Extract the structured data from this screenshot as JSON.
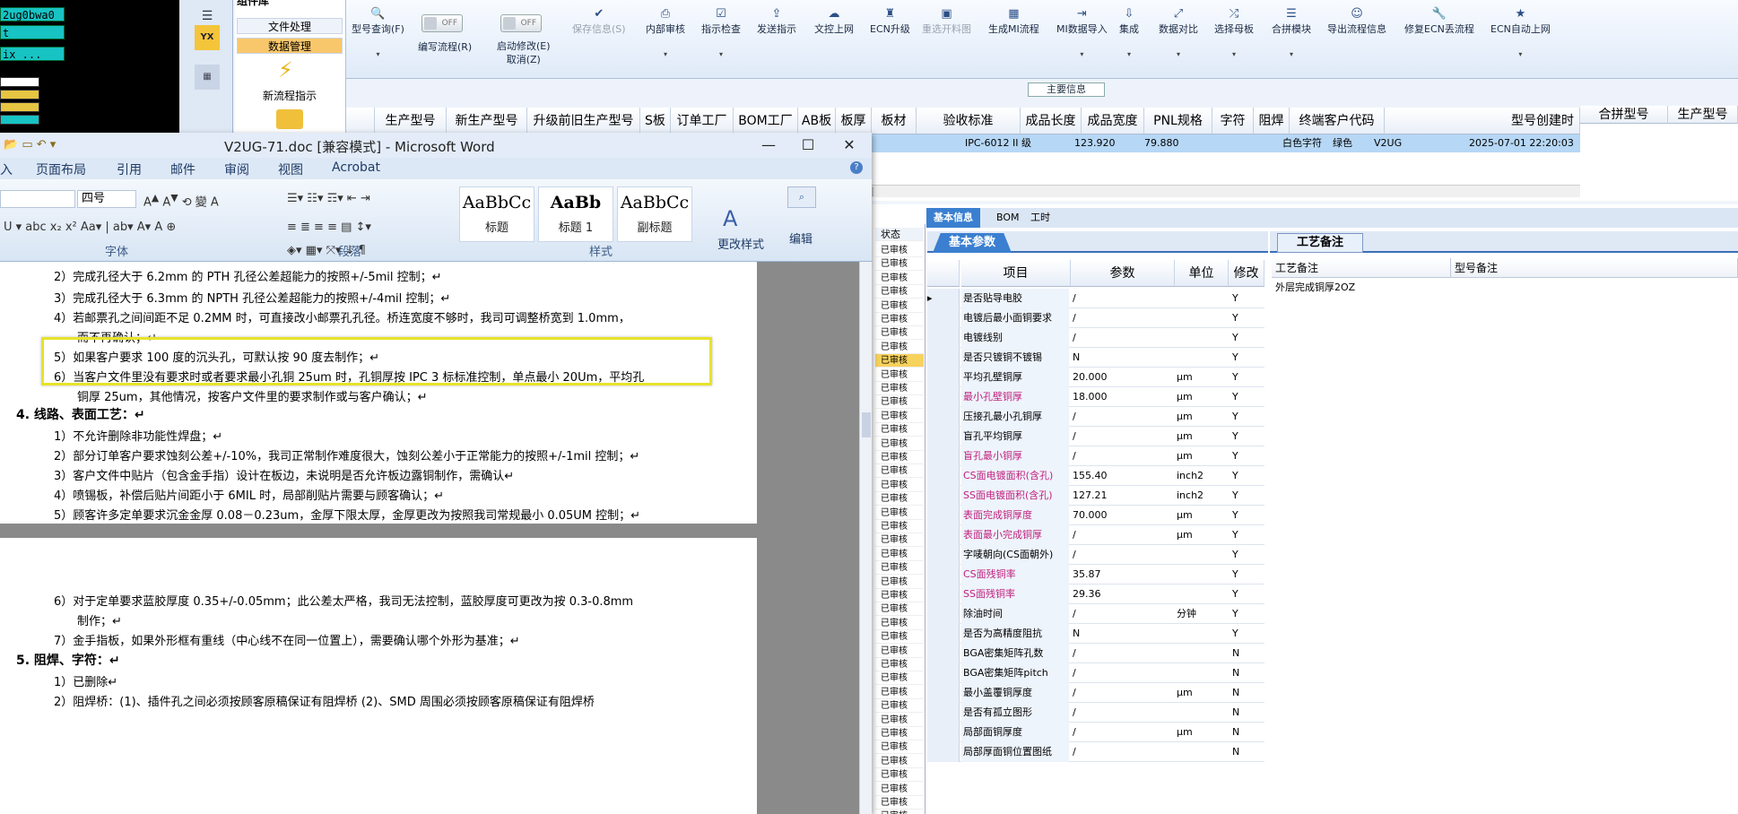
{
  "terminal": {
    "rows": [
      "2ug0bwa0",
      "t",
      "ix ..."
    ]
  },
  "leftnav": {
    "icon1": "YX",
    "top_label": "组件库"
  },
  "leftmenu": {
    "items": [
      "文件处理",
      "数据管理"
    ],
    "new_flow": "新流程指示"
  },
  "toolbar": {
    "items": [
      {
        "label": "型号查询(F)",
        "icon": "🔍",
        "dis": false
      },
      {
        "label": "编写流程(R)",
        "icon": "",
        "dis": false
      },
      {
        "label": "启动修改(E)\n取消(Z)",
        "icon": "",
        "dis": false
      },
      {
        "label": "保存信息(S)",
        "icon": "✔",
        "dis": true
      },
      {
        "label": "内部审核",
        "icon": "🖶",
        "dis": false
      },
      {
        "label": "指示检查",
        "icon": "☑",
        "dis": false
      },
      {
        "label": "发送指示",
        "icon": "⇪",
        "dis": false
      },
      {
        "label": "文控上网",
        "icon": "☁",
        "dis": false
      },
      {
        "label": "ECN升级",
        "icon": "♜",
        "dis": false
      },
      {
        "label": "重选开料图",
        "icon": "▣",
        "dis": true
      },
      {
        "label": "生成MI流程",
        "icon": "▦",
        "dis": false
      },
      {
        "label": "MI数据导入",
        "icon": "⇥",
        "dis": false
      },
      {
        "label": "集成",
        "icon": "⇩",
        "dis": false
      },
      {
        "label": "数据对比",
        "icon": "⤢",
        "dis": false
      },
      {
        "label": "选择母板",
        "icon": "⤮",
        "dis": false
      },
      {
        "label": "合拼模块",
        "icon": "☰",
        "dis": false
      },
      {
        "label": "导出流程信息",
        "icon": "☺",
        "dis": false
      },
      {
        "label": "修复ECN丢流程",
        "icon": "🔧",
        "dis": false
      },
      {
        "label": "ECN自动上网",
        "icon": "★",
        "dis": false
      }
    ],
    "toggle_text": "OFF"
  },
  "maingrid": {
    "section_title": "主要信息",
    "headers": [
      "生产型号",
      "新生产型号",
      "升级前旧生产型号",
      "S板",
      "订单工厂",
      "BOM工厂",
      "AB板",
      "板厚",
      "板材",
      "验收标准",
      "成品长度",
      "成品宽度",
      "PNL规格",
      "字符",
      "阻焊",
      "终端客户代码",
      "型号创建时",
      "合拼型号",
      "生产型号"
    ],
    "row": {
      "standard": "IPC-6012 II 级",
      "length": "123.920",
      "width": "79.880",
      "char": "白色字符",
      "mask": "绿色",
      "cust": "V2UG",
      "time": "2025-07-01 22:20:03"
    }
  },
  "tabs": [
    "基本信息",
    "BOM",
    "工时"
  ],
  "status": {
    "header": "状态",
    "item": "已审核"
  },
  "basic": {
    "tab": "基本参数",
    "headers": {
      "item": "项目",
      "param": "参数",
      "unit": "单位",
      "mod": "修改"
    },
    "rows": [
      {
        "n": "是否贴导电胶",
        "p": "/",
        "u": "",
        "m": "Y",
        "pink": false
      },
      {
        "n": "电镀后最小面铜要求",
        "p": "/",
        "u": "",
        "m": "Y",
        "pink": false
      },
      {
        "n": "电镀线别",
        "p": "/",
        "u": "",
        "m": "Y",
        "pink": false
      },
      {
        "n": "是否只镀铜不镀锡",
        "p": "N",
        "u": "",
        "m": "Y",
        "pink": false
      },
      {
        "n": "平均孔壁铜厚",
        "p": "20.000",
        "u": "μm",
        "m": "Y",
        "pink": false
      },
      {
        "n": "最小孔壁铜厚",
        "p": "18.000",
        "u": "μm",
        "m": "Y",
        "pink": true
      },
      {
        "n": "压接孔最小孔铜厚",
        "p": "/",
        "u": "μm",
        "m": "Y",
        "pink": false
      },
      {
        "n": "盲孔平均铜厚",
        "p": "/",
        "u": "μm",
        "m": "Y",
        "pink": false
      },
      {
        "n": "盲孔最小铜厚",
        "p": "/",
        "u": "μm",
        "m": "Y",
        "pink": true
      },
      {
        "n": "CS面电镀面积(含孔)",
        "p": "155.40",
        "u": "inch2",
        "m": "Y",
        "pink": true
      },
      {
        "n": "SS面电镀面积(含孔)",
        "p": "127.21",
        "u": "inch2",
        "m": "Y",
        "pink": true
      },
      {
        "n": "表面完成铜厚度",
        "p": "70.000",
        "u": "μm",
        "m": "Y",
        "pink": true
      },
      {
        "n": "表面最小完成铜厚",
        "p": "/",
        "u": "μm",
        "m": "Y",
        "pink": true
      },
      {
        "n": "字唛朝向(CS面朝外)",
        "p": "/",
        "u": "",
        "m": "Y",
        "pink": false
      },
      {
        "n": "CS面残铜率",
        "p": "35.87",
        "u": "",
        "m": "Y",
        "pink": true
      },
      {
        "n": "SS面残铜率",
        "p": "29.36",
        "u": "",
        "m": "Y",
        "pink": true
      },
      {
        "n": "除油时间",
        "p": "/",
        "u": "分钟",
        "m": "Y",
        "pink": false
      },
      {
        "n": "是否为高精度阻抗",
        "p": "N",
        "u": "",
        "m": "Y",
        "pink": false
      },
      {
        "n": "BGA密集矩阵孔数",
        "p": "/",
        "u": "",
        "m": "N",
        "pink": false
      },
      {
        "n": "BGA密集矩阵pitch",
        "p": "/",
        "u": "",
        "m": "N",
        "pink": false
      },
      {
        "n": "最小盖覆铜厚度",
        "p": "/",
        "u": "μm",
        "m": "N",
        "pink": false
      },
      {
        "n": "是否有孤立图形",
        "p": "/",
        "u": "",
        "m": "N",
        "pink": false
      },
      {
        "n": "局部面铜厚度",
        "p": "/",
        "u": "μm",
        "m": "N",
        "pink": false
      },
      {
        "n": "局部厚面铜位置图纸",
        "p": "/",
        "u": "",
        "m": "N",
        "pink": false
      }
    ]
  },
  "craft": {
    "tab": "工艺备注",
    "col1": "工艺备注",
    "col2": "型号备注",
    "value": "外层完成铜厚2OZ"
  },
  "word": {
    "title": "V2UG-71.doc [兼容模式] - Microsoft Word",
    "menu": [
      "入",
      "页面布局",
      "引用",
      "邮件",
      "审阅",
      "视图",
      "Acrobat"
    ],
    "font_size": "四号",
    "groups": [
      "字体",
      "段落",
      "样式",
      "编辑"
    ],
    "styles": [
      {
        "big": "AaBbCc",
        "sm": "标题"
      },
      {
        "big": "AaBb",
        "sm": "标题 1"
      },
      {
        "big": "AaBbCc",
        "sm": "副标题"
      }
    ],
    "change_style": "更改样式",
    "edit": "编辑",
    "page1": [
      "2）完成孔径大于 6.2mm 的 PTH 孔径公差超能力的按照+/-5mil 控制；↵",
      "3）完成孔径大于 6.3mm 的 NPTH 孔径公差超能力的按照+/-4mil 控制；↵",
      "4）若邮票孔之间间距不足 0.2MM 时，可直接改小邮票孔孔径。桥连宽度不够时，我司可调整桥宽到 1.0mm，",
      "而不再确认；↵",
      "5）如果客户要求 100 度的沉头孔，可默认按 90 度去制作；↵",
      "6）当客户文件里没有要求时或者要求最小孔铜 25um 时，孔铜厚按 IPC 3 标标准控制，单点最小 20Um，平均孔",
      "铜厚 25um，其他情况，按客户文件里的要求制作或与客户确认；↵",
      "4.  线路、表面工艺：↵",
      "1）不允许删除非功能性焊盘；↵",
      "2）部分订单客户要求蚀刻公差+/-10%，我司正常制作难度很大，蚀刻公差小于正常能力的按照+/-1mil 控制；↵",
      "3）客户文件中贴片（包含金手指）设计在板边，未说明是否允许板边露铜制作，需确认↵",
      "4）喷锡板，补偿后贴片间距小于 6MIL 时，局部削贴片需要与顾客确认；↵",
      "5）顾客许多定单要求沉金金厚 0.08－0.23um，金厚下限太厚，金厚更改为按照我司常规最小 0.05UM 控制；↵"
    ],
    "page2": [
      "6）对于定单要求蓝胶厚度 0.35+/-0.05mm；此公差太严格，我司无法控制，蓝胶厚度可更改为按 0.3-0.8mm",
      "制作；↵",
      "7）金手指板，如果外形框有重线（中心线不在同一位置上），需要确认哪个外形为基准；↵",
      "5.  阻焊、字符：↵",
      "1）已删除↵",
      "2）阻焊桥：(1)、插件孔之间必须按顾客原稿保证有阻焊桥 (2)、SMD 周围必须按顾客原稿保证有阻焊桥"
    ]
  }
}
